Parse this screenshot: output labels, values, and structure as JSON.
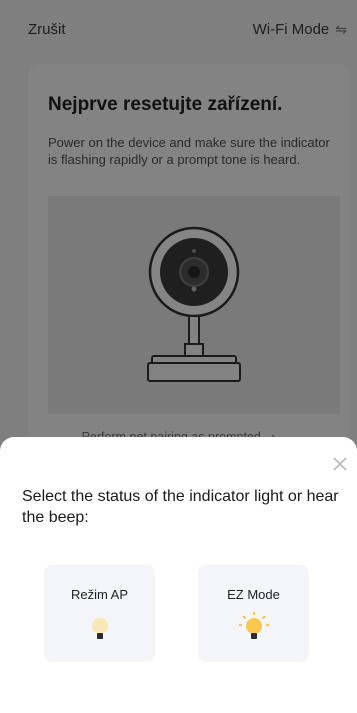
{
  "header": {
    "cancel_label": "Zrušit",
    "mode_label": "Wi-Fi Mode",
    "mode_icon": "swap-arrows-icon"
  },
  "instructions": {
    "title": "Nejprve resetujte zařízení.",
    "description": "Power on the device and make sure the indicator is flashing rapidly or a prompt tone is heard.",
    "illustration": "security-camera-illustration"
  },
  "pairing_link": {
    "label": "Perform net pairing as prompted.",
    "icon": "chevron-right-icon"
  },
  "sheet": {
    "prompt": "Select the status of the indicator light or hear the beep:",
    "close_icon": "close-icon",
    "options": [
      {
        "label": "Režim AP",
        "bulb_state": "slow-blink",
        "bulb_color": "#f7e6b6"
      },
      {
        "label": "EZ Mode",
        "bulb_state": "fast-blink",
        "bulb_color": "#f9c74f"
      }
    ]
  },
  "colors": {
    "overlay": "#7f7f7f",
    "sheet_bg": "#ffffff",
    "option_bg": "#f4f5f8",
    "bulb_glow": "#f5b400"
  }
}
